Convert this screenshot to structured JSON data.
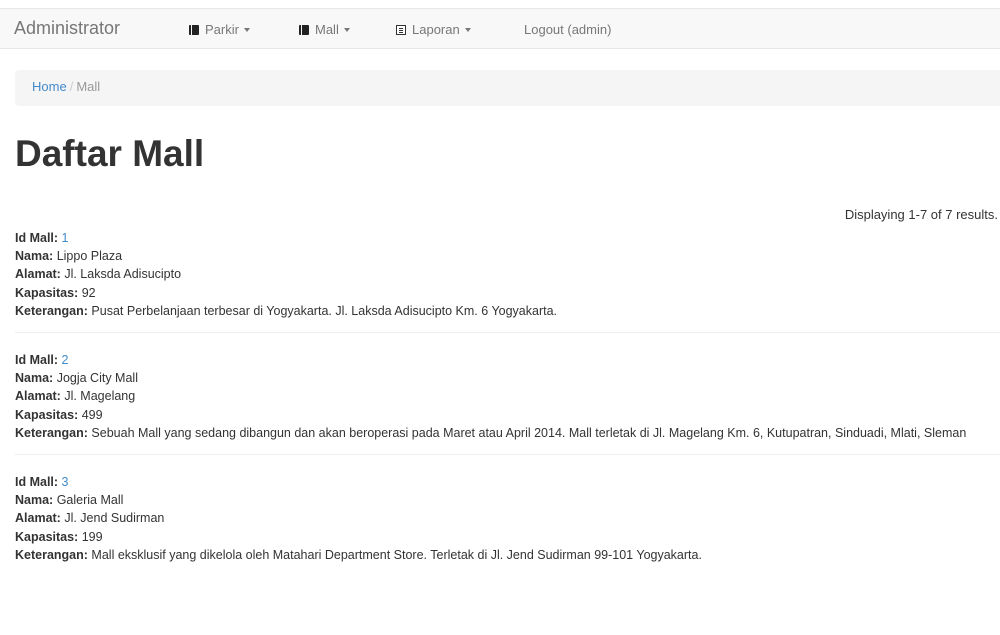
{
  "navbar": {
    "brand": "Administrator",
    "items": [
      {
        "label": "Parkir",
        "icon": "book-icon"
      },
      {
        "label": "Mall",
        "icon": "book-icon"
      },
      {
        "label": "Laporan",
        "icon": "list-icon"
      },
      {
        "label": "Logout (admin)"
      }
    ]
  },
  "breadcrumb": {
    "home": "Home",
    "separator": "/",
    "current": "Mall"
  },
  "page": {
    "title": "Daftar Mall",
    "summary": "Displaying 1-7 of 7 results."
  },
  "labels": {
    "id": "Id Mall:",
    "nama": "Nama:",
    "alamat": "Alamat:",
    "kapasitas": "Kapasitas:",
    "keterangan": "Keterangan:"
  },
  "malls": [
    {
      "id": "1",
      "nama": "Lippo Plaza",
      "alamat": "Jl. Laksda Adisucipto",
      "kapasitas": "92",
      "keterangan": "Pusat Perbelanjaan terbesar di Yogyakarta. Jl. Laksda Adisucipto Km. 6 Yogyakarta."
    },
    {
      "id": "2",
      "nama": "Jogja City Mall",
      "alamat": "Jl. Magelang",
      "kapasitas": "499",
      "keterangan": "Sebuah Mall yang sedang dibangun dan akan beroperasi pada Maret atau April 2014. Mall terletak di Jl. Magelang Km. 6, Kutupatran, Sinduadi, Mlati, Sleman"
    },
    {
      "id": "3",
      "nama": "Galeria Mall",
      "alamat": "Jl. Jend Sudirman",
      "kapasitas": "199",
      "keterangan": "Mall eksklusif yang dikelola oleh Matahari Department Store. Terletak di Jl. Jend Sudirman 99-101 Yogyakarta."
    }
  ]
}
